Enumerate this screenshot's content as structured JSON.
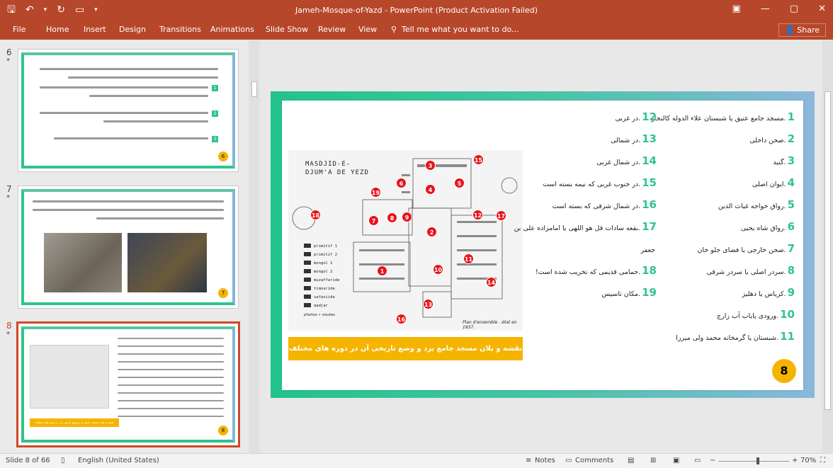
{
  "window": {
    "title": "Jameh-Mosque-of-Yazd  -  PowerPoint (Product Activation Failed)"
  },
  "qat": {
    "save": "🖫",
    "undo": "↶",
    "undo_arrow": "▾",
    "redo": "↻",
    "present": "▭",
    "more": "▾"
  },
  "winctl": {
    "restore_ribbon": "▣",
    "minimize": "—",
    "maximize": "▢",
    "close": "✕"
  },
  "ribbon": {
    "tabs": [
      "File",
      "Home",
      "Insert",
      "Design",
      "Transitions",
      "Animations",
      "Slide Show",
      "Review",
      "View"
    ],
    "tell_me": "Tell me what you want to do...",
    "share": "Share"
  },
  "thumbnails": [
    {
      "number": "6",
      "star": "*",
      "badge": "6",
      "items": [
        "1",
        "2",
        "3"
      ]
    },
    {
      "number": "7",
      "star": "*",
      "badge": "7"
    },
    {
      "number": "8",
      "star": "*",
      "badge": "8",
      "caption": "نقشه و پلان مسجد جامع یزد و وضع تاریخی آن در دوره های مختلف"
    }
  ],
  "slide": {
    "map_title": "MASDJID-E-DJUM'A DE YEZD",
    "map_legend": [
      "primitif 1",
      "primitif 2",
      "mongol 1",
      "mongol 2",
      "muzaffaride",
      "timouride",
      "safaviide",
      "qadjar"
    ],
    "map_scale": "photos • voutes",
    "map_note": "Plan d'ensemble . état en 1937.",
    "pins": [
      "1",
      "2",
      "3",
      "4",
      "5",
      "6",
      "7",
      "8",
      "9",
      "10",
      "11",
      "12",
      "13",
      "14",
      "15",
      "16",
      "17",
      "18",
      "19"
    ],
    "caption": "نقشه و پلان مسجد جامع یزد و وضع تاریخی آن در دوره های مختلف",
    "legend_right": [
      {
        "n": "1",
        "t": "مسجد جامع عتیق یا شبستان علاء الدوله کالنجار"
      },
      {
        "n": "2",
        "t": "صحن داخلی"
      },
      {
        "n": "3",
        "t": "گنبد"
      },
      {
        "n": "4",
        "t": "ایوان اصلی"
      },
      {
        "n": "5",
        "t": "رواق خواجه غیاث الدین"
      },
      {
        "n": "6",
        "t": "رواق شاه یحیی"
      },
      {
        "n": "7",
        "t": "صحن خارجی یا فضای جلو خان"
      },
      {
        "n": "8",
        "t": "سردر اصلی یا سردر شرقی"
      },
      {
        "n": "9",
        "t": "کریاس یا دهلیز"
      },
      {
        "n": "10",
        "t": "ورودی پایاب آب زارچ"
      },
      {
        "n": "11",
        "t": "شبستان یا گرمخانه محمد ولی میرزا"
      }
    ],
    "legend_left": [
      {
        "n": "12",
        "t": "در غربی"
      },
      {
        "n": "13",
        "t": "در شمالی"
      },
      {
        "n": "14",
        "t": "در شمال غربی"
      },
      {
        "n": "15",
        "t": "در جنوب غربی که نیمه بسته است"
      },
      {
        "n": "16",
        "t": "در شمال شرقی که بسته است"
      },
      {
        "n": "17",
        "t": "بقعه سادات قل هو اللهی یا امامزاده علی بن"
      },
      {
        "n": "",
        "t": "جعفر"
      },
      {
        "n": "18",
        "t": "حمامی قدیمی که تخریب شده است!"
      },
      {
        "n": "19",
        "t": "مکان تاسیس"
      }
    ],
    "page_number": "8"
  },
  "status": {
    "slide_info": "Slide 8 of 66",
    "language": "English (United States)",
    "notes": "Notes",
    "comments": "Comments",
    "zoom": "70%"
  }
}
